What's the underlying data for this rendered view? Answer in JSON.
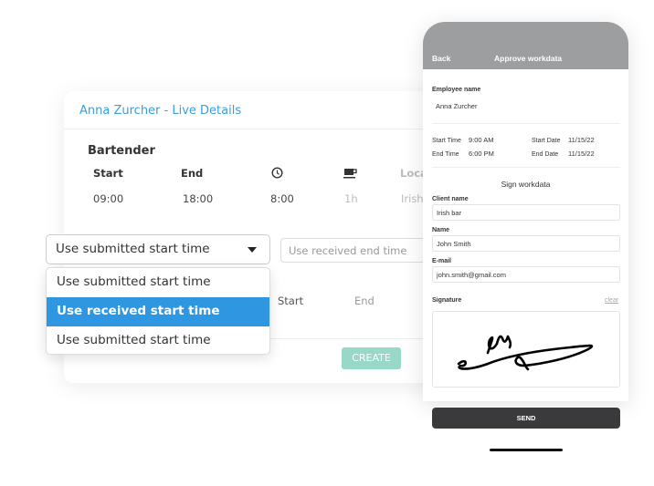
{
  "card": {
    "title": "Anna Zurcher - Live Details",
    "role": "Bartender",
    "headers": {
      "start": "Start",
      "end": "End",
      "duration_icon": "clock-icon",
      "break_icon": "coffee-cup-icon",
      "location": "Loca"
    },
    "values": {
      "start": "09:00",
      "end": "18:00",
      "duration": "8:00",
      "break": "1h",
      "location": "Irish"
    },
    "start_select": {
      "value": "Use submitted start time",
      "options": [
        "Use submitted start time",
        "Use received start time",
        "Use submitted start time"
      ],
      "highlighted_index": 1
    },
    "end_select": {
      "value": "Use received end time"
    },
    "row2_headers": {
      "start": "Start",
      "end": "End"
    },
    "create_label": "CREATE",
    "accent": "#3a9de0",
    "highlight": "#2f96e2"
  },
  "phone": {
    "back": "Back",
    "title": "Approve workdata",
    "employee_label": "Employee name",
    "employee_name": "Anna Zurcher",
    "start_time_label": "Start Time",
    "start_time": "9:00 AM",
    "end_time_label": "End Time",
    "end_time": "6:00 PM",
    "start_date_label": "Start Date",
    "start_date": "11/15/22",
    "end_date_label": "End Date",
    "end_date": "11/15/22",
    "sign_title": "Sign workdata",
    "client_label": "Client name",
    "client": "Irish bar",
    "name_label": "Name",
    "name": "John Smith",
    "email_label": "E-mail",
    "email": "john.smith@gmail.com",
    "signature_label": "Signature",
    "clear": "clear",
    "send": "SEND"
  }
}
